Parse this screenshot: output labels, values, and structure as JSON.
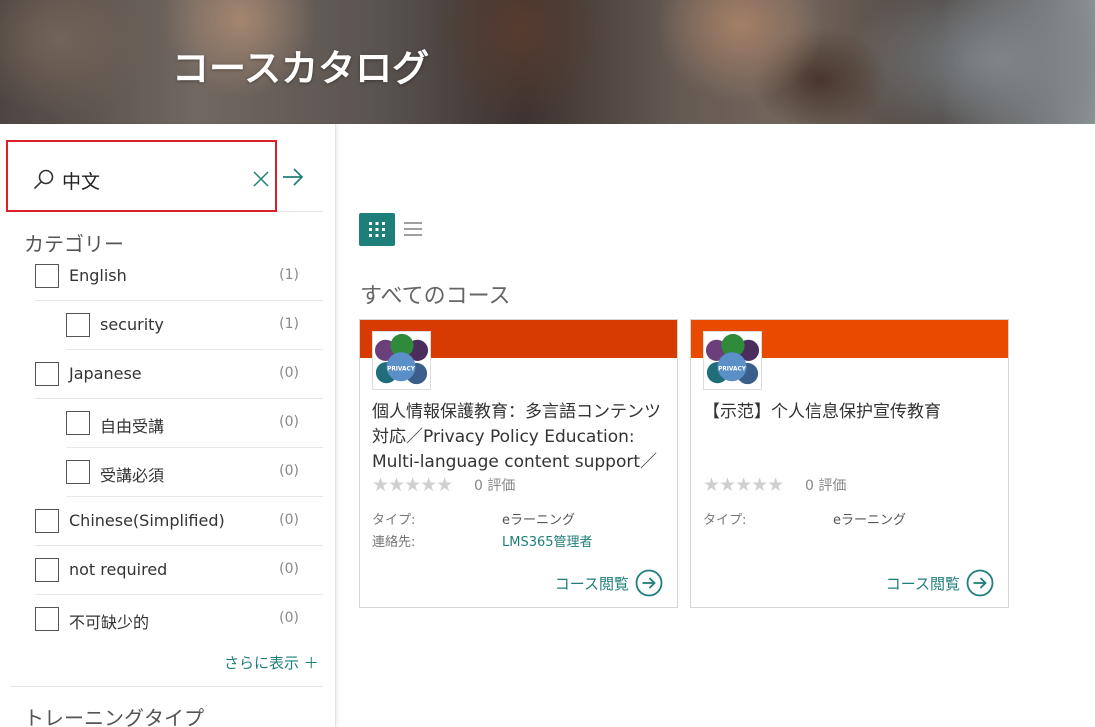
{
  "banner": {
    "title": "コースカタログ"
  },
  "search": {
    "value": "中文"
  },
  "categories": {
    "title": "カテゴリー",
    "items": [
      {
        "label": "English",
        "count": "(1)",
        "level": 0
      },
      {
        "label": "security",
        "count": "(1)",
        "level": 1
      },
      {
        "label": "Japanese",
        "count": "(0)",
        "level": 0
      },
      {
        "label": "自由受講",
        "count": "(0)",
        "level": 1
      },
      {
        "label": "受講必須",
        "count": "(0)",
        "level": 1
      },
      {
        "label": "Chinese(Simplified)",
        "count": "(0)",
        "level": 0
      },
      {
        "label": "not required",
        "count": "(0)",
        "level": 0
      },
      {
        "label": "不可缺少的",
        "count": "(0)",
        "level": 0
      }
    ],
    "show_more": "さらに表示 ＋"
  },
  "training_type": {
    "title": "トレーニングタイプ"
  },
  "main": {
    "heading": "すべてのコース",
    "cards": [
      {
        "title": "個人情報保護教育：多言語コンテンツ対応／Privacy Policy Education: Multi-language content support／",
        "stars": "★★★★★",
        "rating": "0 評価",
        "type_label": "タイプ:",
        "type_value": "eラーニング",
        "contact_label": "連絡先:",
        "contact_value": "LMS365管理者",
        "view_label": "コース閲覧",
        "accent": "#d83b01"
      },
      {
        "title": "【示范】个人信息保护宣传教育",
        "stars": "★★★★★",
        "rating": "0 評価",
        "type_label": "タイプ:",
        "type_value": "eラーニング",
        "view_label": "コース閲覧",
        "accent": "#e84a00"
      }
    ]
  },
  "thumb": {
    "badge_text": "PRIVACY"
  },
  "colors": {
    "accent_teal": "#1e7f7a",
    "highlight_red": "#d92128"
  }
}
